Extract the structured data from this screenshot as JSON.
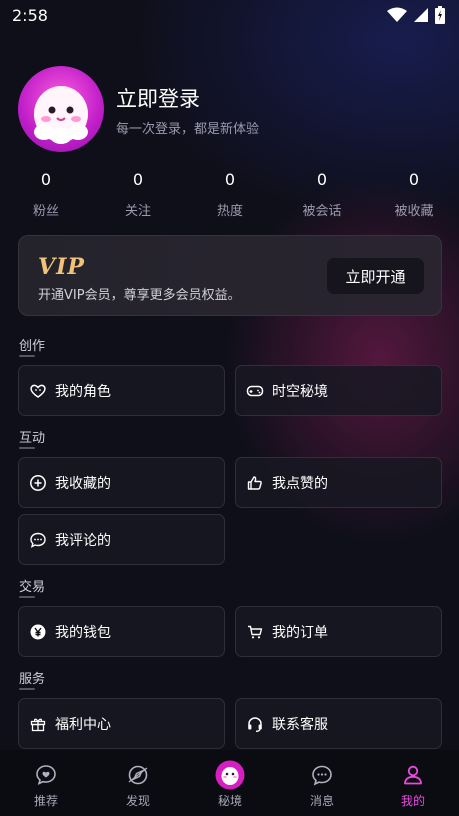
{
  "status_bar": {
    "time": "2:58"
  },
  "profile": {
    "title": "立即登录",
    "subtitle": "每一次登录，都是新体验"
  },
  "stats": [
    {
      "value": "0",
      "label": "粉丝"
    },
    {
      "value": "0",
      "label": "关注"
    },
    {
      "value": "0",
      "label": "热度"
    },
    {
      "value": "0",
      "label": "被会话"
    },
    {
      "value": "0",
      "label": "被收藏"
    }
  ],
  "vip": {
    "logo": "VIP",
    "description": "开通VIP会员，尊享更多会员权益。",
    "button": "立即开通"
  },
  "sections": {
    "create": {
      "title": "创作",
      "items": [
        {
          "label": "我的角色",
          "icon": "heart-face-icon"
        },
        {
          "label": "时空秘境",
          "icon": "gamepad-icon"
        }
      ]
    },
    "interact": {
      "title": "互动",
      "items": [
        {
          "label": "我收藏的",
          "icon": "plus-circle-icon"
        },
        {
          "label": "我点赞的",
          "icon": "thumbs-up-icon"
        },
        {
          "label": "我评论的",
          "icon": "comment-icon"
        }
      ]
    },
    "trade": {
      "title": "交易",
      "items": [
        {
          "label": "我的钱包",
          "icon": "yen-coin-icon"
        },
        {
          "label": "我的订单",
          "icon": "cart-icon"
        }
      ]
    },
    "service": {
      "title": "服务",
      "items": [
        {
          "label": "福利中心",
          "icon": "gift-icon"
        },
        {
          "label": "联系客服",
          "icon": "headset-icon"
        }
      ]
    }
  },
  "bottom_nav": [
    {
      "label": "推荐",
      "icon": "heart-bubble-icon"
    },
    {
      "label": "发现",
      "icon": "compass-icon"
    },
    {
      "label": "秘境",
      "icon": "ghost-icon"
    },
    {
      "label": "消息",
      "icon": "message-icon"
    },
    {
      "label": "我的",
      "icon": "user-icon",
      "active": true
    }
  ],
  "colors": {
    "accent": "#e94be0",
    "vip_gold": "#f0c27a",
    "background": "#0f0f1a"
  }
}
